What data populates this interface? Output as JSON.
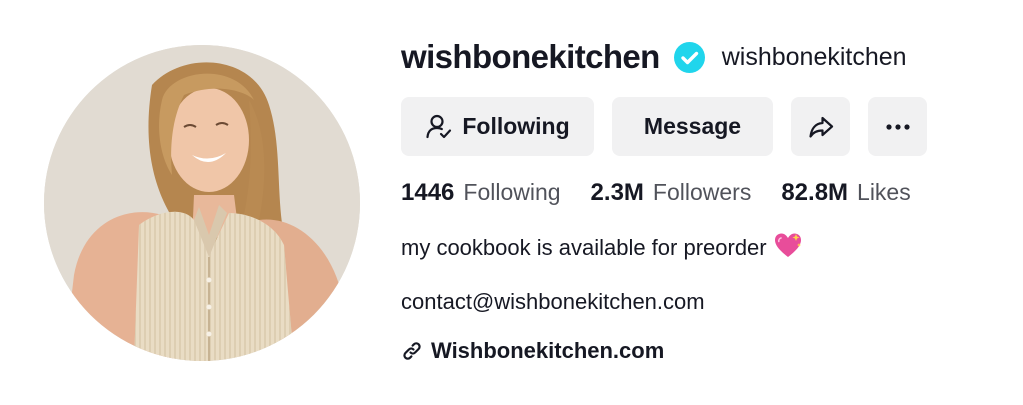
{
  "profile": {
    "unique_id": "wishbonekitchen",
    "nickname": "wishbonekitchen",
    "verified": true
  },
  "buttons": {
    "following_label": "Following",
    "message_label": "Message"
  },
  "stats": {
    "following_count": "1446",
    "following_label": "Following",
    "followers_count": "2.3M",
    "followers_label": "Followers",
    "likes_count": "82.8M",
    "likes_label": "Likes"
  },
  "bio": {
    "line1": "my cookbook is available for preorder",
    "line1_emoji": "💖",
    "line2": "contact@wishbonekitchen.com"
  },
  "link": {
    "text": "Wishbonekitchen.com"
  },
  "colors": {
    "verified_badge": "#20d5ec",
    "button_bg": "#f1f1f2",
    "text_primary": "#161823"
  },
  "icons": {
    "verified": "verified-check-icon",
    "following": "user-check-icon",
    "share": "share-arrow-icon",
    "more": "more-dots-icon",
    "link": "link-icon"
  }
}
